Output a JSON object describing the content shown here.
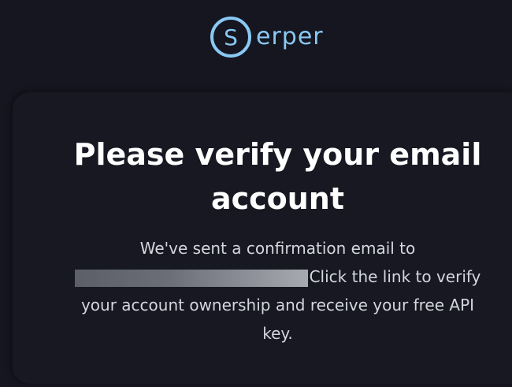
{
  "logo": {
    "icon": "s-circle-logo-icon",
    "text": "erper",
    "color": "#8ac8f4"
  },
  "verify": {
    "title": "Please verify your email account",
    "line1": "We've sent a confirmation email to",
    "email": "",
    "line2": "Click the link to verify your account ownership and receive your free API key."
  },
  "colors": {
    "background": "#151620",
    "card": "#171822",
    "title": "#ffffff",
    "body_text": "#d4d6de",
    "accent": "#8ac8f4"
  }
}
